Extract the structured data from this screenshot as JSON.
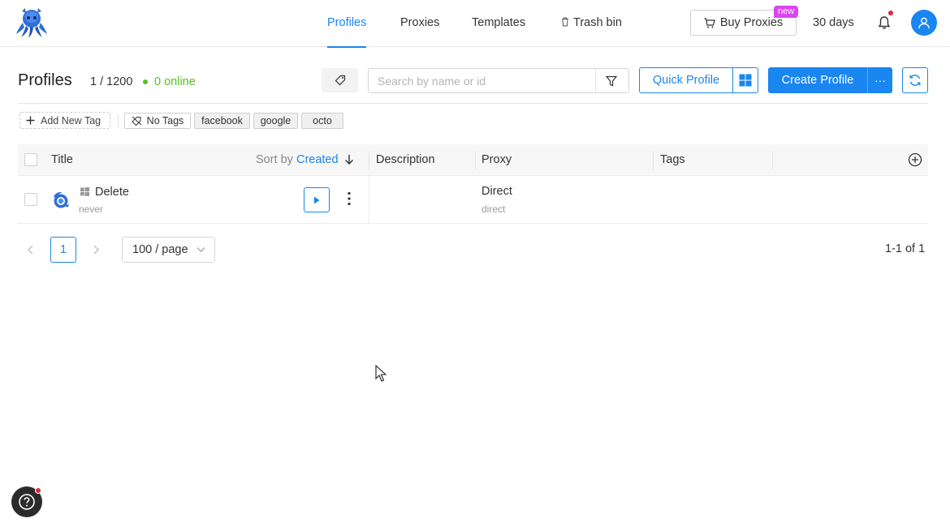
{
  "nav": {
    "items": [
      {
        "label": "Profiles",
        "active": true
      },
      {
        "label": "Proxies",
        "active": false
      },
      {
        "label": "Templates",
        "active": false
      },
      {
        "label": "Trash bin",
        "active": false
      }
    ],
    "buy_label": "Buy Proxies",
    "new_badge": "new",
    "days": "30 days"
  },
  "header": {
    "title": "Profiles",
    "count": "1 / 1200",
    "online": "0 online",
    "search_placeholder": "Search by name or id",
    "quick_profile": "Quick Profile",
    "create_profile": "Create Profile",
    "more_label": "···"
  },
  "tags": {
    "add_label": "Add New Tag",
    "no_tags": "No Tags",
    "chips": [
      "facebook",
      "google",
      "octo"
    ]
  },
  "table": {
    "columns": {
      "title": "Title",
      "sort_by": "Sort by",
      "sort_field": "Created",
      "description": "Description",
      "proxy": "Proxy",
      "tags": "Tags"
    },
    "rows": [
      {
        "name": "Delete",
        "sub": "never",
        "os": "windows-icon",
        "proxy": "Direct",
        "proxy_sub": "direct"
      }
    ]
  },
  "pagination": {
    "current": "1",
    "page_size": "100 / page",
    "total": "1-1 of 1"
  },
  "colors": {
    "accent": "#1a86f0",
    "online": "#52c41a",
    "badge": "#d946ef",
    "alert": "#e0243a"
  }
}
